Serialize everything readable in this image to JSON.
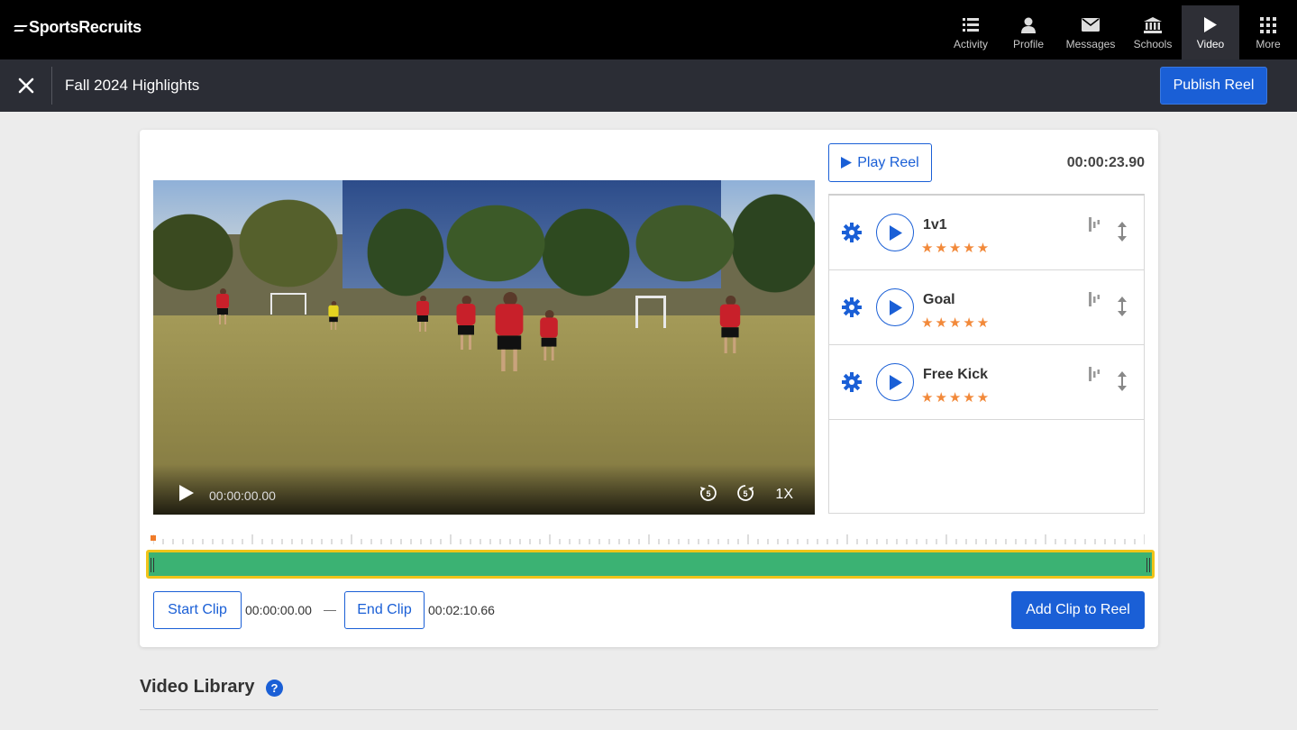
{
  "brand": {
    "name": "SportsRecruits"
  },
  "nav": [
    {
      "label": "Activity",
      "icon": "list-icon"
    },
    {
      "label": "Profile",
      "icon": "person-icon"
    },
    {
      "label": "Messages",
      "icon": "envelope-icon"
    },
    {
      "label": "Schools",
      "icon": "institution-icon"
    },
    {
      "label": "Video",
      "icon": "play-icon",
      "active": true
    },
    {
      "label": "More",
      "icon": "grid-icon"
    }
  ],
  "header": {
    "title": "Fall 2024 Highlights",
    "publish_label": "Publish Reel"
  },
  "player": {
    "current_time": "00:00:00.00",
    "speed": "1X"
  },
  "reel": {
    "play_label": "Play Reel",
    "duration": "00:00:23.90",
    "clips": [
      {
        "name": "1v1",
        "stars": "★★★★★"
      },
      {
        "name": "Goal",
        "stars": "★★★★★"
      },
      {
        "name": "Free Kick",
        "stars": "★★★★★"
      }
    ]
  },
  "clip_editor": {
    "start_label": "Start Clip",
    "start_time": "00:00:00.00",
    "separator": "—",
    "end_label": "End Clip",
    "end_time": "00:02:10.66",
    "add_label": "Add Clip to Reel"
  },
  "library": {
    "title": "Video Library",
    "help": "?"
  },
  "colors": {
    "accent": "#1a5fd6",
    "timeline": "#3bb273",
    "timeline_border": "#f0c419",
    "star": "#f2893a",
    "topbar": "#000000",
    "subbar": "#2b2d35"
  }
}
